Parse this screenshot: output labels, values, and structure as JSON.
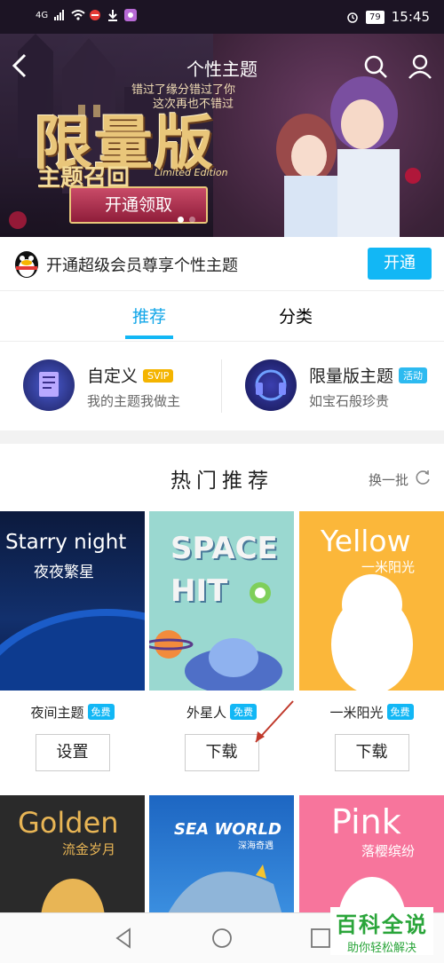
{
  "status": {
    "time": "15:45",
    "battery": "79",
    "signal": "4G"
  },
  "banner": {
    "title": "个性主题",
    "big_title": "限量版",
    "sub_title": "主题召回",
    "limited": "Limited Edition",
    "tagline1": "错过了缘分错过了你",
    "tagline2": "这次再也不错过",
    "button": "开通领取"
  },
  "vip": {
    "text": "开通超级会员尊享个性主题",
    "button": "开通"
  },
  "tabs": {
    "recommend": "推荐",
    "category": "分类"
  },
  "themes": [
    {
      "name": "自定义",
      "badge": "SVIP",
      "desc": "我的主题我做主"
    },
    {
      "name": "限量版主题",
      "badge": "活动",
      "desc": "如宝石般珍贵"
    }
  ],
  "hot": {
    "heading": "热门推荐",
    "refresh": "换一批",
    "free_label": "免费",
    "items": [
      {
        "name": "夜间主题",
        "action": "设置",
        "img_en": "Starry night",
        "img_cn": "夜夜繁星"
      },
      {
        "name": "外星人",
        "action": "下载",
        "img_en1": "SPACE",
        "img_en2": "HIT"
      },
      {
        "name": "一米阳光",
        "action": "下载",
        "img_en": "Yellow",
        "img_cn": "一米阳光"
      }
    ],
    "row2": [
      {
        "img_en": "Golden",
        "img_cn": "流金岁月"
      },
      {
        "img_en": "SEA WORLD",
        "img_cn": "深海奇遇"
      },
      {
        "img_en": "Pink",
        "img_cn": "落樱缤纷"
      }
    ]
  },
  "watermark": {
    "big": "百科全说",
    "small": "助你轻松解决"
  },
  "colors": {
    "accent": "#12b7f5",
    "svip": "#f4b400",
    "event": "#2dbaf0"
  }
}
